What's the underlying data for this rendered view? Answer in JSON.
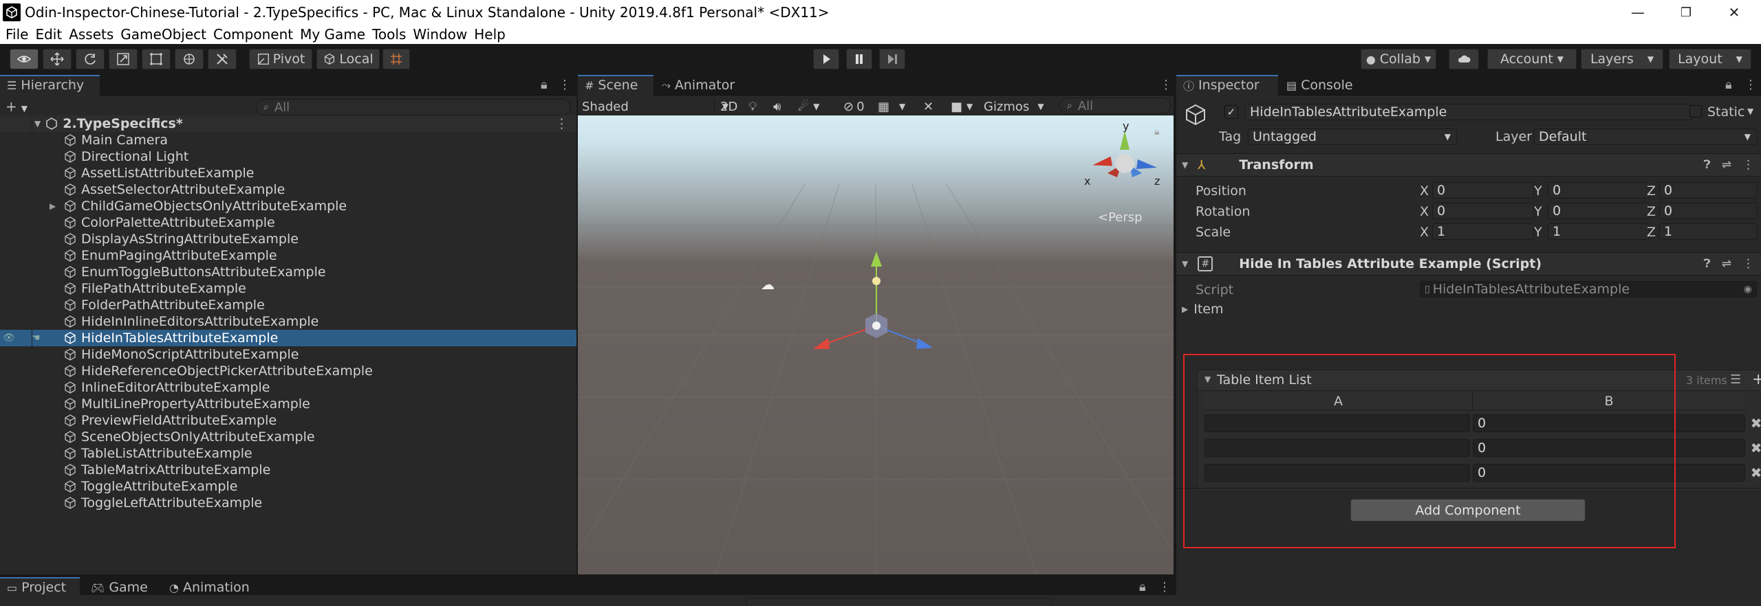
{
  "window": {
    "title": "Odin-Inspector-Chinese-Tutorial - 2.TypeSpecifics - PC, Mac & Linux Standalone - Unity 2019.4.8f1 Personal* <DX11>",
    "minimize": "—",
    "maximize": "❐",
    "close": "✕"
  },
  "menu": [
    "File",
    "Edit",
    "Assets",
    "GameObject",
    "Component",
    "My Game",
    "Tools",
    "Window",
    "Help"
  ],
  "toolbar": {
    "pivot_label": "Pivot",
    "local_label": "Local",
    "collab_label": "Collab",
    "account_label": "Account",
    "layers_label": "Layers",
    "layout_label": "Layout"
  },
  "hierarchy": {
    "tab_label": "Hierarchy",
    "search_placeholder": "All",
    "scene_name": "2.TypeSpecifics*",
    "items": [
      "Main Camera",
      "Directional Light",
      "AssetListAttributeExample",
      "AssetSelectorAttributeExample",
      "ChildGameObjectsOnlyAttributeExample",
      "ColorPaletteAttributeExample",
      "DisplayAsStringAttributeExample",
      "EnumPagingAttributeExample",
      "EnumToggleButtonsAttributeExample",
      "FilePathAttributeExample",
      "FolderPathAttributeExample",
      "HideInInlineEditorsAttributeExample",
      "HideInTablesAttributeExample",
      "HideMonoScriptAttributeExample",
      "HideReferenceObjectPickerAttributeExample",
      "InlineEditorAttributeExample",
      "MultiLinePropertyAttributeExample",
      "PreviewFieldAttributeExample",
      "SceneObjectsOnlyAttributeExample",
      "TableListAttributeExample",
      "TableMatrixAttributeExample",
      "ToggleAttributeExample",
      "ToggleLeftAttributeExample"
    ],
    "selected_index": 12
  },
  "scene": {
    "tab_scene": "Scene",
    "tab_animator": "Animator",
    "shading_mode": "Shaded",
    "mode_2d": "2D",
    "hidden_count": "0",
    "gizmos_label": "Gizmos",
    "search_placeholder": "All",
    "persp_label": "Persp",
    "gizmo_x": "x",
    "gizmo_y": "y",
    "gizmo_z": "z"
  },
  "inspector": {
    "tab_inspector": "Inspector",
    "tab_console": "Console",
    "object_name": "HideInTablesAttributeExample",
    "static_label": "Static",
    "tag_label": "Tag",
    "tag_value": "Untagged",
    "layer_label": "Layer",
    "layer_value": "Default",
    "transform": {
      "title": "Transform",
      "position_label": "Position",
      "rotation_label": "Rotation",
      "scale_label": "Scale",
      "axis_x": "X",
      "axis_y": "Y",
      "axis_z": "Z",
      "position": [
        "0",
        "0",
        "0"
      ],
      "rotation": [
        "0",
        "0",
        "0"
      ],
      "scale": [
        "1",
        "1",
        "1"
      ]
    },
    "script_component": {
      "title": "Hide In Tables Attribute Example (Script)",
      "script_label": "Script",
      "script_value": "HideInTablesAttributeExample",
      "item_label": "Item"
    },
    "table": {
      "title": "Table Item List",
      "count_label": "3 items",
      "column_a": "A",
      "column_b": "B",
      "rows": [
        {
          "a": "",
          "b": "0"
        },
        {
          "a": "",
          "b": "0"
        },
        {
          "a": "",
          "b": "0"
        }
      ]
    },
    "add_component_label": "Add Component"
  },
  "bottom": {
    "tab_project": "Project",
    "tab_game": "Game",
    "tab_animation": "Animation"
  }
}
